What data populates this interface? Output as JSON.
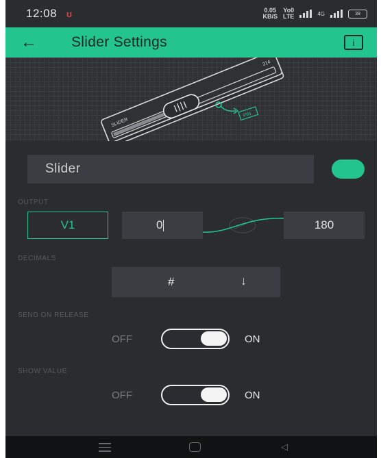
{
  "status_bar": {
    "time": "12:08",
    "net_speed_value": "0.05",
    "net_speed_unit": "KB/S",
    "volte_top": "Yo0",
    "volte_bottom": "LTE",
    "network_type": "4G",
    "battery_level": "39"
  },
  "app_bar": {
    "title": "Slider Settings",
    "back_icon": "arrow-left-icon",
    "info_label": "i"
  },
  "preview": {
    "widget_label": "SLIDER",
    "widget_value": "314",
    "pin_label": "PIN"
  },
  "widget": {
    "name": "Slider",
    "color": "#23c48e"
  },
  "output": {
    "label": "OUTPUT",
    "pin": "V1",
    "min": "0",
    "max": "180"
  },
  "decimals": {
    "label": "DECIMALS",
    "value": "#",
    "arrow": "↓"
  },
  "send_on_release": {
    "label": "SEND ON RELEASE",
    "off": "OFF",
    "on": "ON",
    "state": "on"
  },
  "show_value": {
    "label": "SHOW VALUE",
    "off": "OFF",
    "on": "ON",
    "state": "on"
  },
  "colors": {
    "accent": "#23c48e",
    "background": "#2a2c30",
    "field": "#3b3d42"
  }
}
